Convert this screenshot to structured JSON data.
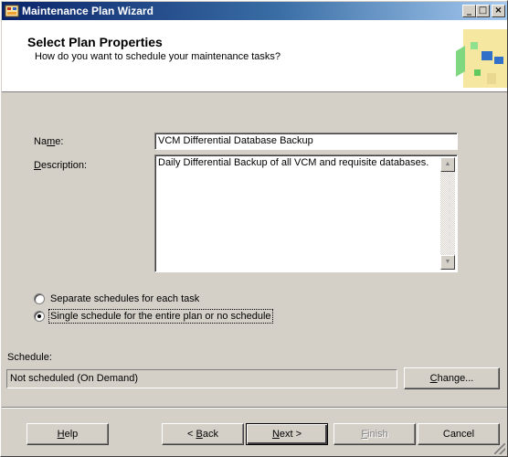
{
  "window": {
    "title": "Maintenance Plan Wizard",
    "buttons": {
      "minimize": "_",
      "maximize": "□",
      "close": "×"
    }
  },
  "header": {
    "title": "Select Plan Properties",
    "subtitle": "How do you want to schedule your maintenance tasks?"
  },
  "form": {
    "name_label_pre": "Na",
    "name_label_accel": "m",
    "name_label_post": "e:",
    "name_value": "VCM Differential Database Backup",
    "description_label_accel": "D",
    "description_label_post": "escription:",
    "description_value": "Daily Differential Backup of all VCM and requisite databases."
  },
  "schedule_options": [
    {
      "label": "Separate schedules for each task",
      "checked": false
    },
    {
      "label": "Single schedule for the entire plan or no schedule",
      "checked": true
    }
  ],
  "schedule": {
    "label": "Schedule:",
    "value": "Not scheduled (On Demand)",
    "change_accel": "C",
    "change_post": "hange..."
  },
  "footer": {
    "help_accel": "H",
    "help_post": "elp",
    "back_pre": "< ",
    "back_accel": "B",
    "back_post": "ack",
    "next_accel": "N",
    "next_post": "ext >",
    "finish_accel": "F",
    "finish_post": "inish",
    "cancel_label": "Cancel"
  },
  "colors": {
    "titlebar_start": "#0a246a",
    "titlebar_end": "#a6caf0",
    "dialog_face": "#d4d0c8"
  }
}
